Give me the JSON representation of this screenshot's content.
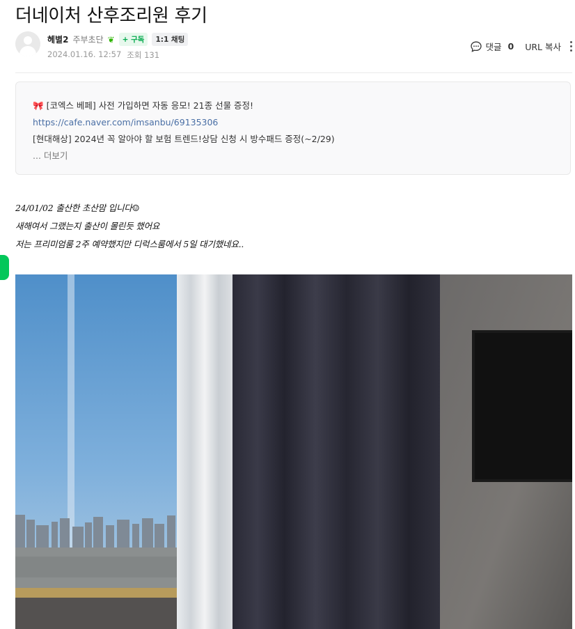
{
  "post": {
    "title": "더네이처 산후조리원 후기",
    "author": {
      "nickname": "헤별2",
      "rank": "주부초단",
      "subscribe_label": "+ 구독",
      "chat_label": "1:1 채팅"
    },
    "date": "2024.01.16. 12:57",
    "views": "조회 131",
    "comment_label": "댓글",
    "comment_count": "0",
    "url_copy_label": "URL 복사"
  },
  "notice": {
    "line1": "[코엑스 베페] 사전 가입하면 자동 응모! 21종 선물 증정!",
    "link": "https://cafe.naver.com/imsanbu/69135306",
    "line2": "[현대해상] 2024년 꼭 알아야 할 보험 트렌드!상담 신청 시 방수패드 증정(~2/29)",
    "more_label": "... 더보기"
  },
  "body": {
    "lines": [
      "24/01/02 출산한 초산맘 입니다☺",
      "새해여서 그랬는지 출산이 몰린듯 했어요",
      "저는 프리미엄룸 2주 예약했지만 디럭스룸에서 5일 대기했네요.."
    ]
  },
  "colors": {
    "accent_green": "#03c75a",
    "link_blue": "#4a6fa5",
    "chip_green": "#03a94d"
  },
  "icons": {
    "comment": "speech-bubble-icon",
    "more": "vertical-dots-icon",
    "bow": "ribbon-bow-icon"
  }
}
